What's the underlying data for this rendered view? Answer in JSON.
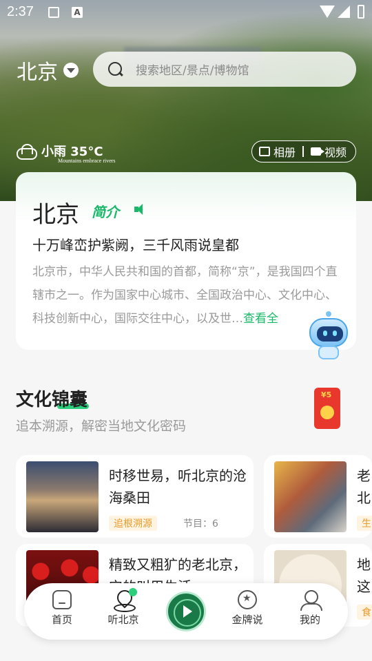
{
  "status_bar": {
    "time": "2:37",
    "a_label": "A"
  },
  "header": {
    "city": "北京",
    "search_placeholder": "搜索地区/景点/博物馆",
    "weather": "小雨 35°C",
    "weather_caption": "Mountains embrace rivers",
    "album_label": "相册",
    "video_label": "视频"
  },
  "intro": {
    "city": "北京",
    "tag": "简介",
    "slogan": "十万峰峦护紫阙，三千风雨说皇都",
    "description": "北京市，中华人民共和国的首都，简称“京”，是我国四个直辖市之一。作为国家中心城市、全国政治中心、文化中心、科技创新中心，国际交往中心，以及世…",
    "more": "查看全"
  },
  "culture": {
    "title": "文化锦囊",
    "subtitle": "追本溯源，解密当地文化密码",
    "redpacket_label": "¥5"
  },
  "cards": [
    {
      "title": "时移世易，听北京的沧海桑田",
      "tag": "追根溯源",
      "count": "节目：6"
    },
    {
      "title": "老北一",
      "tag": "生",
      "count": ""
    },
    {
      "title": "精致又粗犷的老北京，它的叫用生活",
      "tag": "",
      "count": ""
    },
    {
      "title": "地这",
      "tag": "食",
      "count": ""
    }
  ],
  "bottom_nav": {
    "home": "首页",
    "listen": "听北京",
    "medal": "金牌说",
    "me": "我的"
  }
}
